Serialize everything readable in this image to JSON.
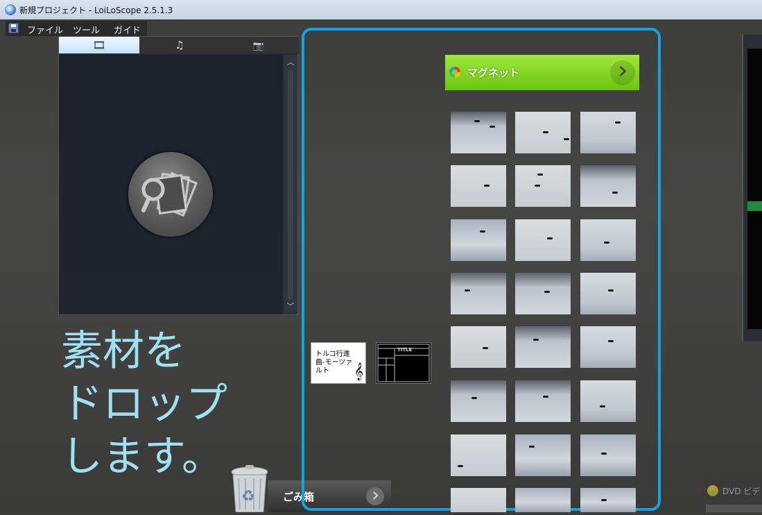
{
  "window": {
    "title": "新規プロジェクト - LoiLoScope 2.5.1.3"
  },
  "menu": {
    "file": "ファイル",
    "tools": "ツール",
    "guide": "ガイド"
  },
  "library": {
    "tabs": [
      {
        "icon": "film-icon",
        "glyph": "🎞"
      },
      {
        "icon": "music-note-icon",
        "glyph": "♫"
      },
      {
        "icon": "camera-icon",
        "glyph": "📷"
      }
    ],
    "active_tab": 0
  },
  "drop_prompt": {
    "line1": "素材を",
    "line2": "ドロップ",
    "line3": "します。"
  },
  "trash": {
    "label": "ごみ箱"
  },
  "magnet": {
    "label": "マグネット"
  },
  "music_item": {
    "title": "トルコ行進曲-モーツァルト",
    "clef": "𝄞"
  },
  "title_item": {
    "caption": "TITLE"
  },
  "dvd": {
    "label": "DVD ビデ"
  },
  "colors": {
    "accent": "#12a3e6",
    "magnet": "#7fd11f",
    "drop_text": "#9fe0f3"
  }
}
